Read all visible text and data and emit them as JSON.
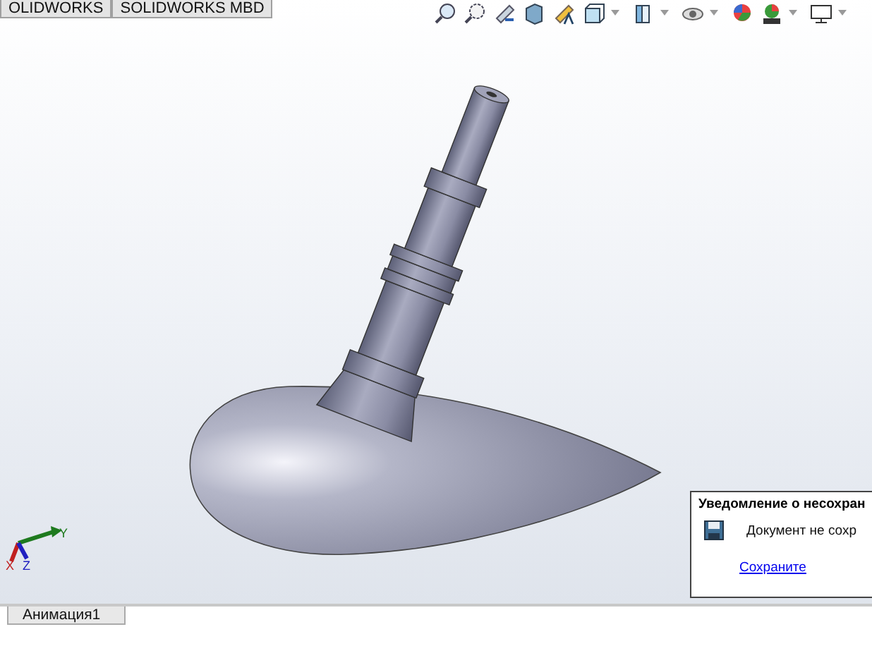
{
  "tabs": [
    {
      "label": "OLIDWORKS",
      "selected": false
    },
    {
      "label": "SOLIDWORKS MBD",
      "selected": false
    }
  ],
  "triad": {
    "x": "X",
    "y": "Y",
    "z": "Z"
  },
  "notification": {
    "title": "Уведомление о несохран",
    "message": "Документ не сохр",
    "link": "Сохраните"
  },
  "bottom_tabs": [
    {
      "label": "Анимация1",
      "selected": true
    }
  ]
}
